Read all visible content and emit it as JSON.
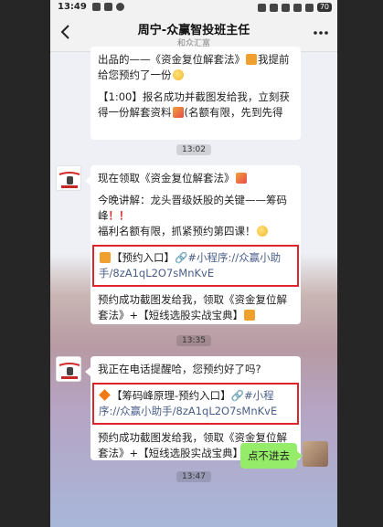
{
  "status_bar": {
    "time": "13:49",
    "battery": "70"
  },
  "header": {
    "title": "周宁-众赢智投班主任",
    "subtitle": "和众汇富"
  },
  "messages": {
    "m0": {
      "line1": "出品的——《资金复位解套法》",
      "line1b": "我提前给您预约了一份",
      "line2": "【1:00】报名成功并截图发给我，立刻获得一份解套资料",
      "line2b": "(名额有限，先到先得"
    },
    "ts1": "13:02",
    "m1": {
      "p1": "现在领取《资金复位解套法》",
      "p2a": "今晚讲解：龙头晋级妖股的关键——筹码峰",
      "p2b": "福利名额有限，抓紧预约第四课！",
      "box_a": "【预约入口】",
      "box_b": "#小程序://众赢小助手/8zA1qL2O7sMnKvE",
      "p4a": "预约成功截图发给我，领取《资金复位解套法》+【短线选股实战宝典】"
    },
    "ts2": "13:35",
    "m2": {
      "p1": "我正在电话提醒哈，您预约好了吗?",
      "box_a": "【筹码峰原理-预约入口】",
      "box_b": "#小程序://众赢小助手/8zA1qL2O7sMnKvE",
      "p3": "预约成功截图发给我，领取《资金复位解套法》+【短线选股实战宝典】"
    },
    "ts3": "13:47",
    "my_reply": "点不进去"
  }
}
